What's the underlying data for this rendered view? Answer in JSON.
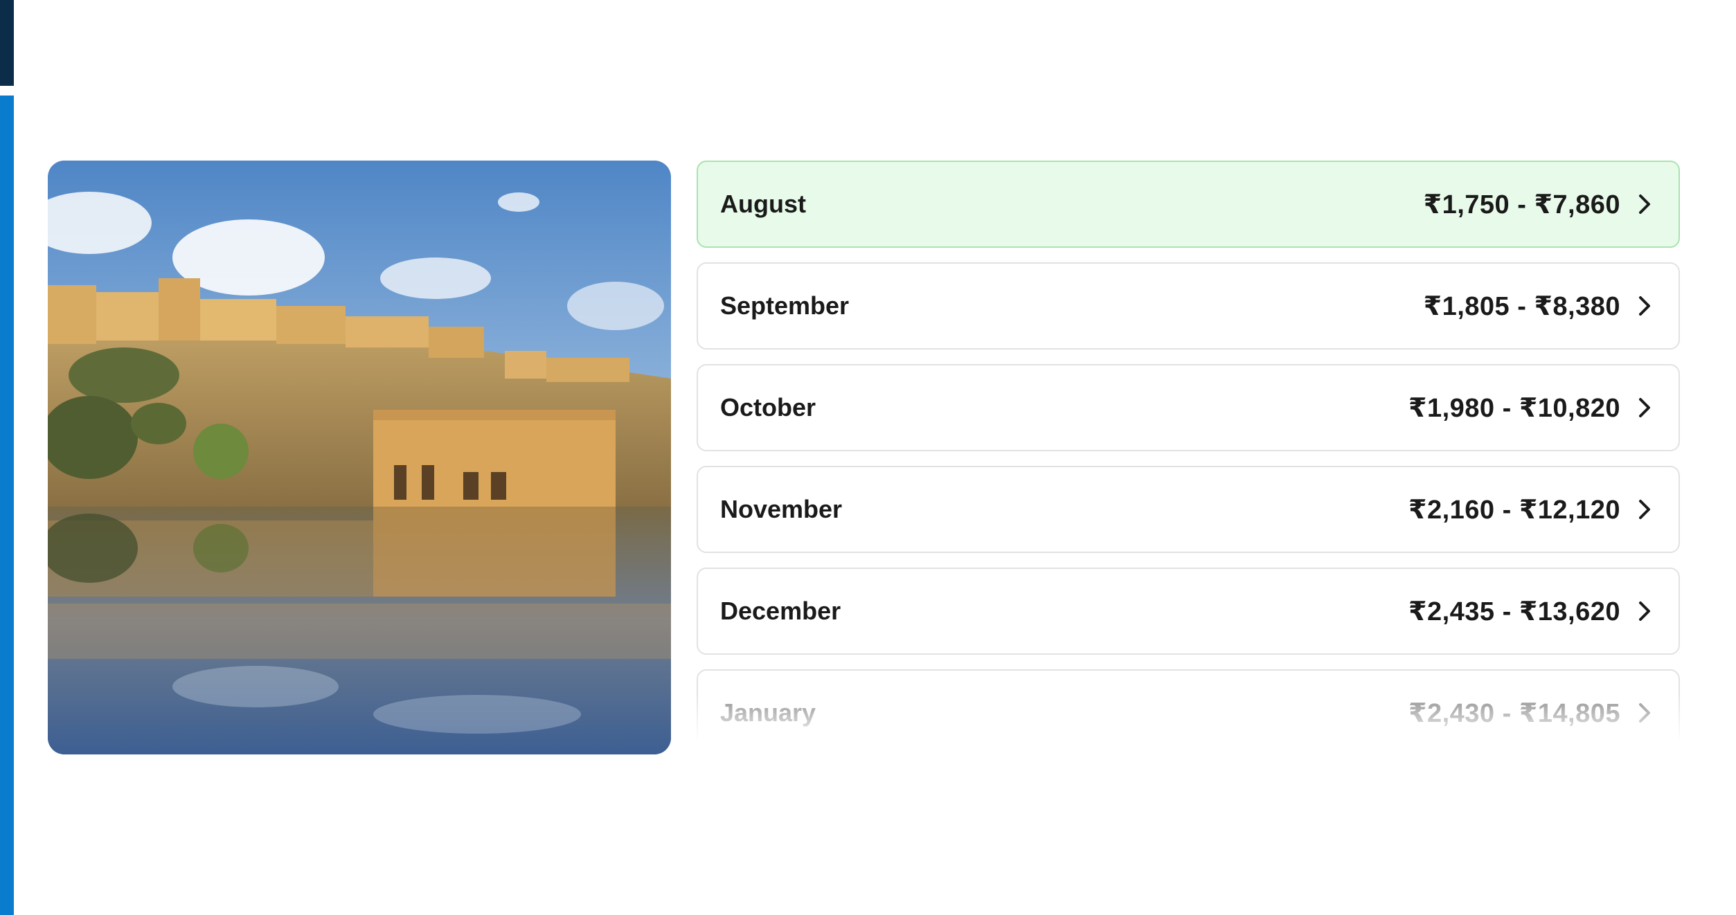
{
  "hero_image": {
    "icon": "fort-lake-photo"
  },
  "months": [
    {
      "name": "August",
      "price_range": "₹1,750 - ₹7,860",
      "selected": true
    },
    {
      "name": "September",
      "price_range": "₹1,805 - ₹8,380",
      "selected": false
    },
    {
      "name": "October",
      "price_range": "₹1,980 - ₹10,820",
      "selected": false
    },
    {
      "name": "November",
      "price_range": "₹2,160 - ₹12,120",
      "selected": false
    },
    {
      "name": "December",
      "price_range": "₹2,435 - ₹13,620",
      "selected": false
    },
    {
      "name": "January",
      "price_range": "₹2,430 - ₹14,805",
      "selected": false
    }
  ],
  "colors": {
    "selected_bg": "#e8fbea",
    "selected_border": "#a8e3b0",
    "accent_bar": "#0a7ccd",
    "dark_bar": "#0b2d4a"
  }
}
